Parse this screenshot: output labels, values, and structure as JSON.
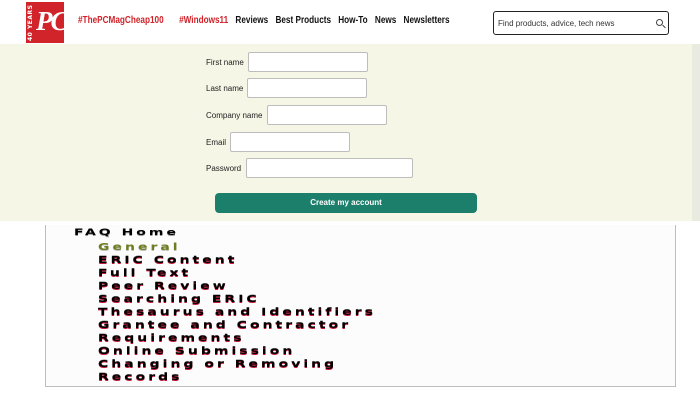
{
  "header": {
    "logo": {
      "text": "PC",
      "years": "40 YEARS"
    },
    "nav": [
      {
        "label": "#ThePCMagCheap100",
        "style": "hot"
      },
      {
        "label": "#Windows11",
        "style": "hot"
      },
      {
        "label": "Reviews",
        "style": "plain"
      },
      {
        "label": "Best Products",
        "style": "plain"
      },
      {
        "label": "How-To",
        "style": "plain"
      },
      {
        "label": "News",
        "style": "plain"
      },
      {
        "label": "Newsletters",
        "style": "plain"
      }
    ],
    "search": {
      "placeholder": "Find products, advice, tech news",
      "icon": "search-icon"
    }
  },
  "form": {
    "fields": [
      {
        "label": "First name",
        "value": ""
      },
      {
        "label": "Last name",
        "value": ""
      },
      {
        "label": "Company name",
        "value": ""
      },
      {
        "label": "Email",
        "value": ""
      },
      {
        "label": "Password",
        "value": ""
      }
    ],
    "submit_label": "Create my account"
  },
  "faq": {
    "title": "FAQ Home",
    "items": [
      {
        "label": "General",
        "active": true
      },
      {
        "label": "ERIC Content",
        "active": false
      },
      {
        "label": "Full Text",
        "active": false
      },
      {
        "label": "Peer Review",
        "active": false
      },
      {
        "label": "Searching ERIC",
        "active": false
      },
      {
        "label": "Thesaurus and Identifiers",
        "active": false
      },
      {
        "label": "Grantee and Contractor",
        "active": false
      },
      {
        "label": "Requirements",
        "active": false
      },
      {
        "label": "Online Submission",
        "active": false
      },
      {
        "label": "Changing or Removing",
        "active": false
      },
      {
        "label": "Records",
        "active": false
      }
    ]
  },
  "colors": {
    "brand_red": "#d1232a",
    "button_green": "#1c7f6c",
    "form_background": "#f5f6e6",
    "faq_active": "#6f7d20"
  }
}
